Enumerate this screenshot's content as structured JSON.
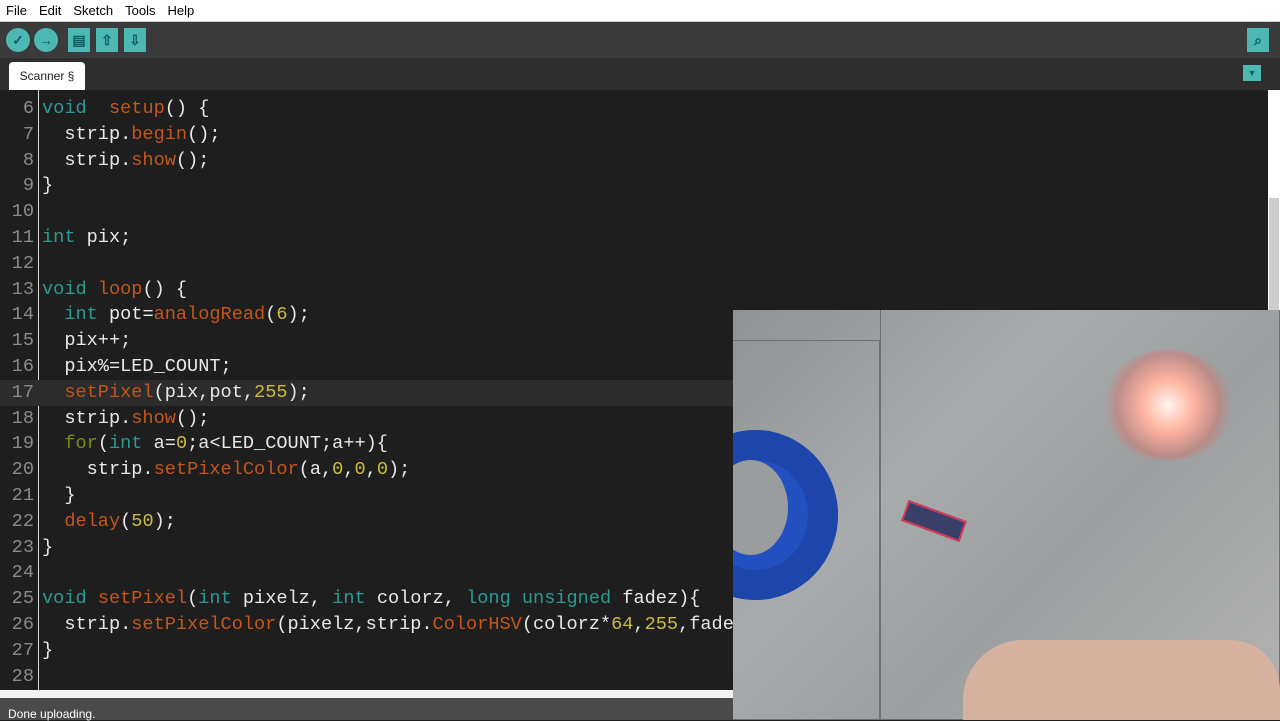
{
  "menu": [
    "File",
    "Edit",
    "Sketch",
    "Tools",
    "Help"
  ],
  "toolbar": {
    "verify": "✓",
    "upload": "→",
    "new": "▤",
    "open": "⇧",
    "save": "⇩",
    "serial_monitor": "⌕"
  },
  "tab": {
    "label": "Scanner §",
    "menu_icon": "▼"
  },
  "code": [
    {
      "n": "6",
      "t": [
        [
          "kw",
          "void"
        ],
        [
          "",
          "  "
        ],
        [
          "fn",
          "setup"
        ],
        [
          "",
          "() {"
        ]
      ]
    },
    {
      "n": "7",
      "t": [
        [
          "",
          "  strip."
        ],
        [
          "fn",
          "begin"
        ],
        [
          "",
          "();"
        ]
      ]
    },
    {
      "n": "8",
      "t": [
        [
          "",
          "  strip."
        ],
        [
          "fn",
          "show"
        ],
        [
          "",
          "();"
        ]
      ]
    },
    {
      "n": "9",
      "t": [
        [
          "",
          "}"
        ]
      ]
    },
    {
      "n": "10",
      "t": []
    },
    {
      "n": "11",
      "t": [
        [
          "kw",
          "int"
        ],
        [
          "",
          " pix;"
        ]
      ]
    },
    {
      "n": "12",
      "t": []
    },
    {
      "n": "13",
      "t": [
        [
          "kw",
          "void"
        ],
        [
          "",
          " "
        ],
        [
          "fn",
          "loop"
        ],
        [
          "",
          "() {"
        ]
      ]
    },
    {
      "n": "14",
      "t": [
        [
          "",
          "  "
        ],
        [
          "kw",
          "int"
        ],
        [
          "",
          " pot="
        ],
        [
          "fn",
          "analogRead"
        ],
        [
          "",
          "("
        ],
        [
          "num",
          "6"
        ],
        [
          "",
          ");"
        ]
      ]
    },
    {
      "n": "15",
      "t": [
        [
          "",
          "  pix++;"
        ]
      ]
    },
    {
      "n": "16",
      "t": [
        [
          "",
          "  pix%=LED_COUNT;"
        ]
      ]
    },
    {
      "n": "17",
      "t": [
        [
          "",
          "  "
        ],
        [
          "fn",
          "setPixel"
        ],
        [
          "",
          "(pix,pot,"
        ],
        [
          "num",
          "255"
        ],
        [
          "",
          ");"
        ]
      ],
      "current": true
    },
    {
      "n": "18",
      "t": [
        [
          "",
          "  strip."
        ],
        [
          "fn",
          "show"
        ],
        [
          "",
          "();"
        ]
      ]
    },
    {
      "n": "19",
      "t": [
        [
          "",
          "  "
        ],
        [
          "ctl",
          "for"
        ],
        [
          "",
          "("
        ],
        [
          "kw",
          "int"
        ],
        [
          "",
          " a="
        ],
        [
          "num",
          "0"
        ],
        [
          "",
          ";a<LED_COUNT;a++){"
        ]
      ]
    },
    {
      "n": "20",
      "t": [
        [
          "",
          "    strip."
        ],
        [
          "fn",
          "setPixelColor"
        ],
        [
          "",
          "(a,"
        ],
        [
          "num",
          "0"
        ],
        [
          "",
          ","
        ],
        [
          "num",
          "0"
        ],
        [
          "",
          ","
        ],
        [
          "num",
          "0"
        ],
        [
          "",
          ");"
        ]
      ]
    },
    {
      "n": "21",
      "t": [
        [
          "",
          "  }"
        ]
      ]
    },
    {
      "n": "22",
      "t": [
        [
          "",
          "  "
        ],
        [
          "fn",
          "delay"
        ],
        [
          "",
          "("
        ],
        [
          "num",
          "50"
        ],
        [
          "",
          ");"
        ]
      ]
    },
    {
      "n": "23",
      "t": [
        [
          "",
          "}"
        ]
      ]
    },
    {
      "n": "24",
      "t": []
    },
    {
      "n": "25",
      "t": [
        [
          "kw",
          "void"
        ],
        [
          "",
          " "
        ],
        [
          "fn",
          "setPixel"
        ],
        [
          "",
          "("
        ],
        [
          "kw",
          "int"
        ],
        [
          "",
          " pixelz, "
        ],
        [
          "kw",
          "int"
        ],
        [
          "",
          " colorz, "
        ],
        [
          "kw",
          "long unsigned"
        ],
        [
          "",
          " fadez){"
        ]
      ]
    },
    {
      "n": "26",
      "t": [
        [
          "",
          "  strip."
        ],
        [
          "fn",
          "setPixelColor"
        ],
        [
          "",
          "(pixelz,strip."
        ],
        [
          "fn",
          "ColorHSV"
        ],
        [
          "",
          "(colorz*"
        ],
        [
          "num",
          "64"
        ],
        [
          "",
          ","
        ],
        [
          "num",
          "255"
        ],
        [
          "",
          ",fadez));"
        ]
      ]
    },
    {
      "n": "27",
      "t": [
        [
          "",
          "}"
        ]
      ]
    },
    {
      "n": "28",
      "t": []
    }
  ],
  "status": "Done uploading.",
  "colors": {
    "accent": "#4db7b3",
    "keyword": "#2a9a94",
    "function": "#c2561c",
    "number": "#cdbd3c"
  }
}
